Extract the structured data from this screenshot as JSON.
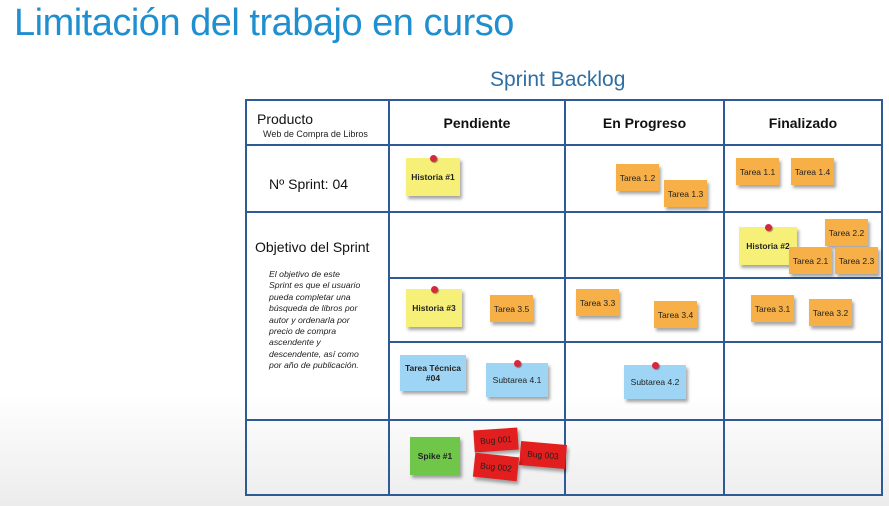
{
  "slide": {
    "title": "Limitación del trabajo en curso"
  },
  "board": {
    "title": "Sprint Backlog",
    "columns": [
      "Pendiente",
      "En Progreso",
      "Finalizado"
    ],
    "product_label": "Producto",
    "product_name": "Web de Compra de Libros",
    "sprint_label": "Nº Sprint: 04",
    "goal_label": "Objetivo del Sprint",
    "goal_text": "El objetivo de este Sprint es que el usuario pueda completar una búsqueda de libros por autor y ordenarla por precio de compra ascendente y descendente, así como por año de publicación."
  },
  "notes": {
    "historia1": "Historia #1",
    "historia2": "Historia #2",
    "historia3": "Historia #3",
    "tarea11": "Tarea 1.1",
    "tarea12": "Tarea 1.2",
    "tarea13": "Tarea 1.3",
    "tarea14": "Tarea 1.4",
    "tarea21": "Tarea 2.1",
    "tarea22": "Tarea 2.2",
    "tarea23": "Tarea 2.3",
    "tarea31": "Tarea 3.1",
    "tarea32": "Tarea 3.2",
    "tarea33": "Tarea 3.3",
    "tarea34": "Tarea 3.4",
    "tarea35": "Tarea 3.5",
    "tarea_tecnica": "Tarea Técnica #04",
    "subtarea41": "Subtarea 4.1",
    "subtarea42": "Subtarea 4.2",
    "spike": "Spike #1",
    "bug001": "Bug 001",
    "bug002": "Bug 002",
    "bug003": "Bug 003"
  },
  "colors": {
    "title": "#1f8fd0",
    "grid": "#2e5a96",
    "story": "#f7f078",
    "task": "#f7b047",
    "subtask": "#9fd5f4",
    "spike": "#6fc649",
    "bug": "#e31e1e"
  }
}
